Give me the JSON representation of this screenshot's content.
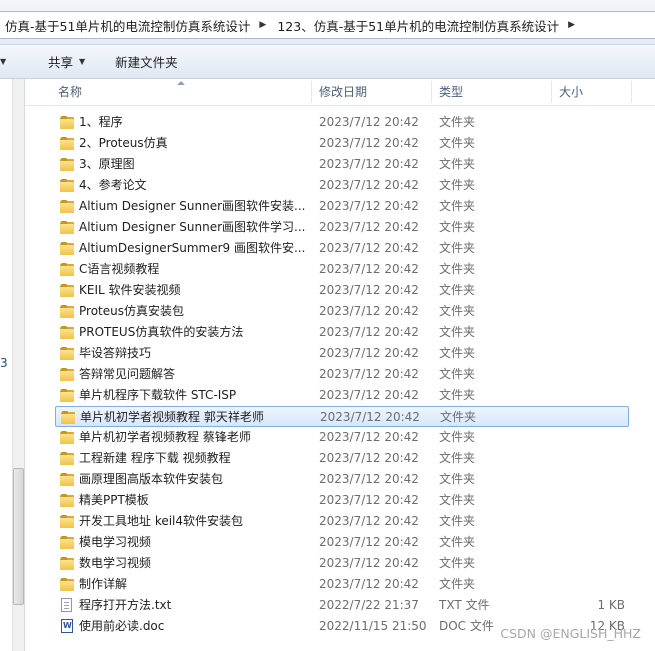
{
  "address": {
    "crumbs": [
      "仿真-基于51单片机的电流控制仿真系统设计",
      "123、仿真-基于51单片机的电流控制仿真系统设计"
    ]
  },
  "toolbar": {
    "share_label": "共享",
    "new_folder_label": "新建文件夹"
  },
  "columns": {
    "name": "名称",
    "date": "修改日期",
    "type": "类型",
    "size": "大小"
  },
  "nav": {
    "marker": "3"
  },
  "files": [
    {
      "name": "1、程序",
      "date": "2023/7/12 20:42",
      "type": "文件夹",
      "size": "",
      "icon": "folder"
    },
    {
      "name": "2、Proteus仿真",
      "date": "2023/7/12 20:42",
      "type": "文件夹",
      "size": "",
      "icon": "folder"
    },
    {
      "name": "3、原理图",
      "date": "2023/7/12 20:42",
      "type": "文件夹",
      "size": "",
      "icon": "folder"
    },
    {
      "name": "4、参考论文",
      "date": "2023/7/12 20:42",
      "type": "文件夹",
      "size": "",
      "icon": "folder"
    },
    {
      "name": "Altium Designer Sunner画图软件安装...",
      "date": "2023/7/12 20:42",
      "type": "文件夹",
      "size": "",
      "icon": "folder"
    },
    {
      "name": "Altium Designer Sunner画图软件学习...",
      "date": "2023/7/12 20:42",
      "type": "文件夹",
      "size": "",
      "icon": "folder"
    },
    {
      "name": "AltiumDesignerSummer9 画图软件安...",
      "date": "2023/7/12 20:42",
      "type": "文件夹",
      "size": "",
      "icon": "folder"
    },
    {
      "name": "C语言视频教程",
      "date": "2023/7/12 20:42",
      "type": "文件夹",
      "size": "",
      "icon": "folder"
    },
    {
      "name": "KEIL 软件安装视频",
      "date": "2023/7/12 20:42",
      "type": "文件夹",
      "size": "",
      "icon": "folder"
    },
    {
      "name": "Proteus仿真安装包",
      "date": "2023/7/12 20:42",
      "type": "文件夹",
      "size": "",
      "icon": "folder"
    },
    {
      "name": "PROTEUS仿真软件的安装方法",
      "date": "2023/7/12 20:42",
      "type": "文件夹",
      "size": "",
      "icon": "folder"
    },
    {
      "name": "毕设答辩技巧",
      "date": "2023/7/12 20:42",
      "type": "文件夹",
      "size": "",
      "icon": "folder"
    },
    {
      "name": "答辩常见问题解答",
      "date": "2023/7/12 20:42",
      "type": "文件夹",
      "size": "",
      "icon": "folder"
    },
    {
      "name": "单片机程序下载软件 STC-ISP",
      "date": "2023/7/12 20:42",
      "type": "文件夹",
      "size": "",
      "icon": "folder"
    },
    {
      "name": "单片机初学者视频教程 郭天祥老师",
      "date": "2023/7/12 20:42",
      "type": "文件夹",
      "size": "",
      "icon": "folder",
      "selected": true
    },
    {
      "name": "单片机初学者视频教程 蔡锋老师",
      "date": "2023/7/12 20:42",
      "type": "文件夹",
      "size": "",
      "icon": "folder"
    },
    {
      "name": "工程新建  程序下载 视频教程",
      "date": "2023/7/12 20:42",
      "type": "文件夹",
      "size": "",
      "icon": "folder"
    },
    {
      "name": "画原理图高版本软件安装包",
      "date": "2023/7/12 20:42",
      "type": "文件夹",
      "size": "",
      "icon": "folder"
    },
    {
      "name": "精美PPT模板",
      "date": "2023/7/12 20:42",
      "type": "文件夹",
      "size": "",
      "icon": "folder"
    },
    {
      "name": "开发工具地址 keil4软件安装包",
      "date": "2023/7/12 20:42",
      "type": "文件夹",
      "size": "",
      "icon": "folder"
    },
    {
      "name": "模电学习视频",
      "date": "2023/7/12 20:42",
      "type": "文件夹",
      "size": "",
      "icon": "folder"
    },
    {
      "name": "数电学习视频",
      "date": "2023/7/12 20:42",
      "type": "文件夹",
      "size": "",
      "icon": "folder"
    },
    {
      "name": "制作详解",
      "date": "2023/7/12 20:42",
      "type": "文件夹",
      "size": "",
      "icon": "folder"
    },
    {
      "name": "程序打开方法.txt",
      "date": "2022/7/22 21:37",
      "type": "TXT 文件",
      "size": "1 KB",
      "icon": "txt"
    },
    {
      "name": "使用前必读.doc",
      "date": "2022/11/15 21:50",
      "type": "DOC 文件",
      "size": "12 KB",
      "icon": "doc"
    }
  ],
  "watermark": "CSDN @ENGLISH_HHZ"
}
